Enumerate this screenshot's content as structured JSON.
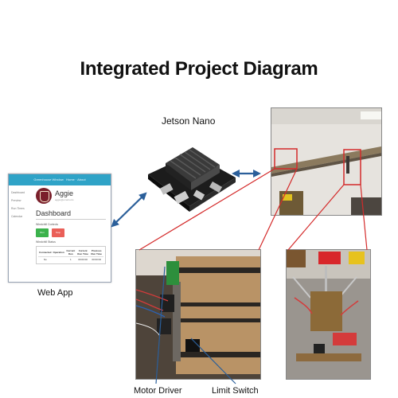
{
  "title": "Integrated Project Diagram",
  "labels": {
    "jetson": "Jetson Nano",
    "webapp": "Web App",
    "motor_driver": "Motor Driver",
    "limit_switch": "Limit Switch"
  },
  "webapp": {
    "header": "Greenhouse Window",
    "header_links": "Home · About",
    "sidebar": [
      "Dashboard",
      "Preview",
      "Run Times",
      "Calendar"
    ],
    "brand": "Aggie",
    "brand_sub": "aggie@email.edu",
    "dashboard": "Dashboard",
    "controls_label": "Windchill Controls",
    "run_label": "Run",
    "stop_label": "Stop",
    "status_label": "Windchill Status",
    "table_headers": [
      "Connected",
      "Operation",
      "Current Run",
      "Current Run Time",
      "Previous Run Time"
    ],
    "table_row": [
      "No",
      "",
      "1",
      "00:00:00",
      "00:00:00"
    ]
  },
  "colors": {
    "arrow": "#2b5f9a",
    "callout": "#d42a2a",
    "webapp_header": "#2fa3c7",
    "run_button": "#3bb24c",
    "stop_button": "#ea5f58"
  }
}
